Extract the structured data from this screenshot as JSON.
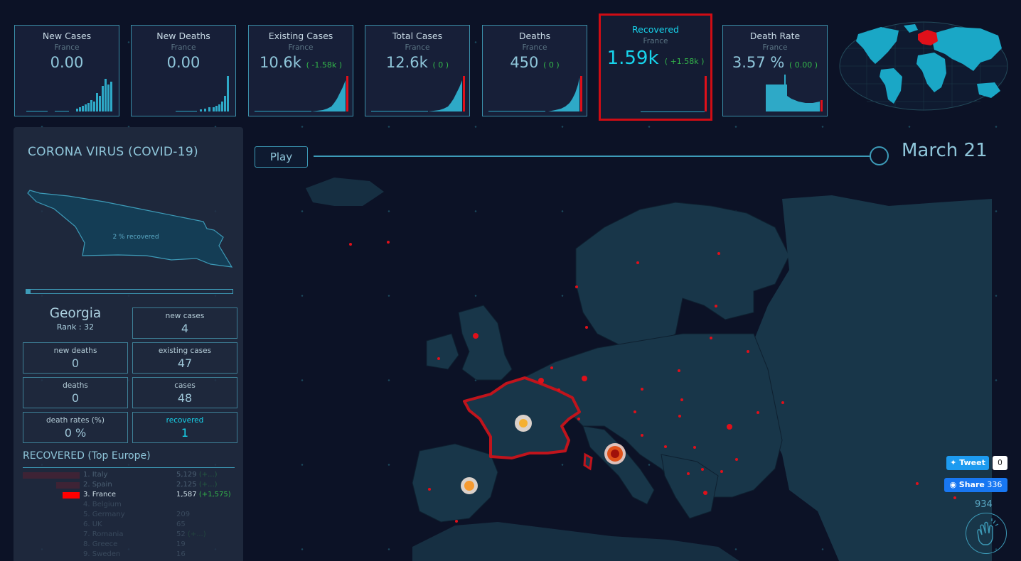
{
  "cards": [
    {
      "title": "New Cases",
      "country": "France",
      "value": "0.00",
      "delta": ""
    },
    {
      "title": "New Deaths",
      "country": "France",
      "value": "0.00",
      "delta": ""
    },
    {
      "title": "Existing Cases",
      "country": "France",
      "value": "10.6k",
      "delta": "( -1.58k )"
    },
    {
      "title": "Total Cases",
      "country": "France",
      "value": "12.6k",
      "delta": "( 0 )"
    },
    {
      "title": "Deaths",
      "country": "France",
      "value": "450",
      "delta": "( 0 )"
    },
    {
      "title": "Recovered",
      "country": "France",
      "value": "1.59k",
      "delta": "( +1.58k )"
    },
    {
      "title": "Death Rate",
      "country": "France",
      "value": "3.57 %",
      "delta": "( 0.00 )"
    }
  ],
  "panel": {
    "title": "CORONA VIRUS (COVID-19)",
    "country_shape_label": "2 % recovered",
    "recovered_fraction": 0.02,
    "country": "Georgia",
    "rank": "Rank : 32",
    "stats": {
      "new_cases_label": "new cases",
      "new_cases": "4",
      "new_deaths_label": "new deaths",
      "new_deaths": "0",
      "existing_cases_label": "existing cases",
      "existing_cases": "47",
      "deaths_label": "deaths",
      "deaths": "0",
      "cases_label": "cases",
      "cases": "48",
      "death_rates_label": "death rates (%)",
      "death_rates": "0 %",
      "recovered_label": "recovered",
      "recovered": "1"
    },
    "toplist_title": "RECOVERED (Top Europe)",
    "toplist": [
      {
        "name": "1. Italy",
        "count": "5,129",
        "delta": "(+...)",
        "color": "#6b1a24",
        "opacity": 0.35
      },
      {
        "name": "2. Spain",
        "count": "2,125",
        "delta": "(+...)",
        "color": "#6b1a24",
        "opacity": 0.35
      },
      {
        "name": "3. France",
        "count": "1,587",
        "delta": "(+1,575)",
        "color": "#ff0000",
        "opacity": 1
      },
      {
        "name": "4. Belgium",
        "count": "",
        "delta": "",
        "color": "#6b1a24",
        "opacity": 0.2
      },
      {
        "name": "5. Germany",
        "count": "209",
        "delta": "",
        "color": "#6b1a24",
        "opacity": 0.2
      },
      {
        "name": "6. UK",
        "count": "65",
        "delta": "",
        "color": "#6b1a24",
        "opacity": 0.2
      },
      {
        "name": "7. Romania",
        "count": "52",
        "delta": "(+...)",
        "color": "#6b1a24",
        "opacity": 0.2
      },
      {
        "name": "8. Greece",
        "count": "19",
        "delta": "",
        "color": "#6b1a24",
        "opacity": 0.2
      },
      {
        "name": "9. Sweden",
        "count": "16",
        "delta": "",
        "color": "#6b1a24",
        "opacity": 0.2
      }
    ]
  },
  "timeline": {
    "play_label": "Play",
    "date": "March 21"
  },
  "social": {
    "tweet_label": "Tweet",
    "tweet_count": "0",
    "share_label": "Share",
    "share_count": "336",
    "claps": "934"
  },
  "colors": {
    "accent": "#3d9bb8",
    "highlight": "#d00c14",
    "positive": "#33b54a",
    "cyan": "#17d4ec"
  }
}
